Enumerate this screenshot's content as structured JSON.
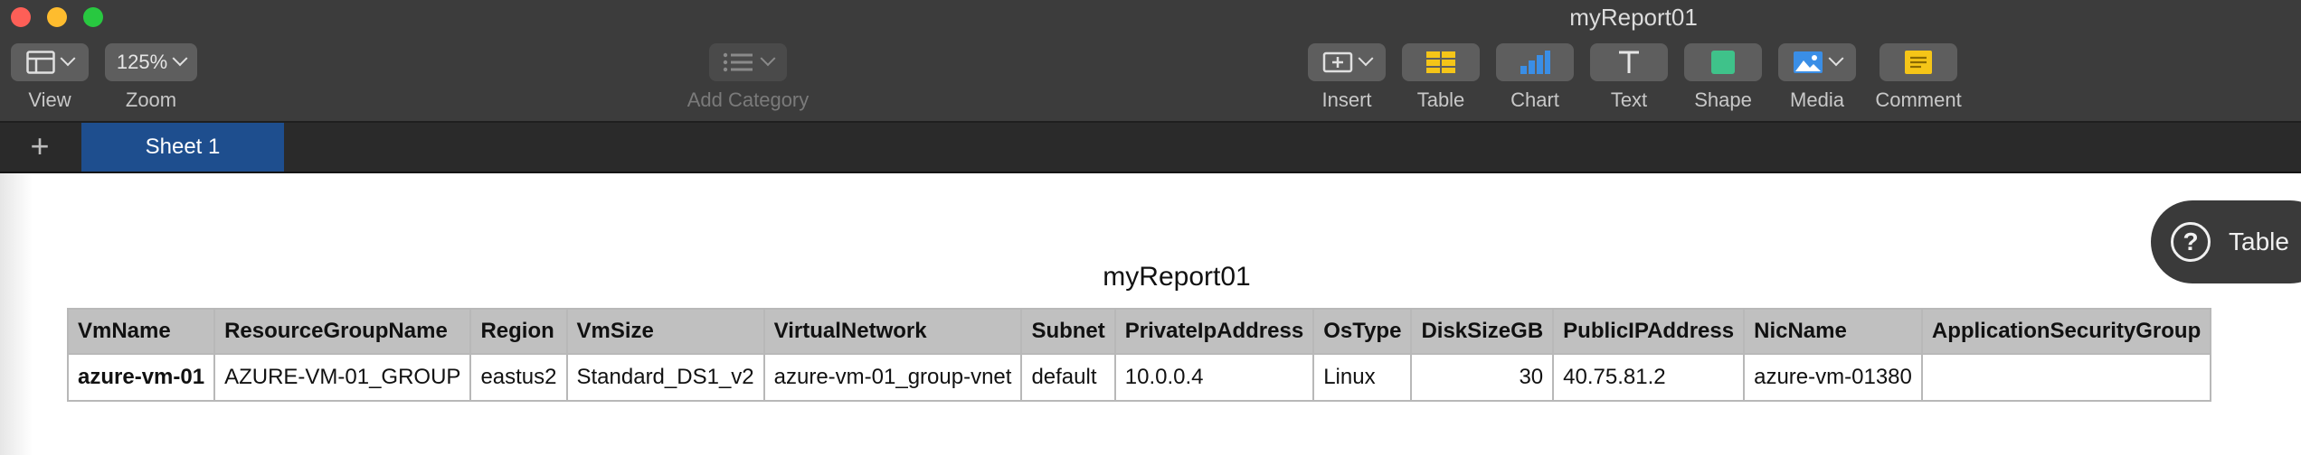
{
  "window": {
    "title": "myReport01"
  },
  "toolbar": {
    "view_label": "View",
    "zoom_value": "125%",
    "zoom_label": "Zoom",
    "add_category_label": "Add Category",
    "insert_label": "Insert",
    "table_label": "Table",
    "chart_label": "Chart",
    "text_label": "Text",
    "shape_label": "Shape",
    "media_label": "Media",
    "comment_label": "Comment"
  },
  "sheets": {
    "add_symbol": "+",
    "active": "Sheet 1"
  },
  "report": {
    "title": "myReport01",
    "columns": [
      "VmName",
      "ResourceGroupName",
      "Region",
      "VmSize",
      "VirtualNetwork",
      "Subnet",
      "PrivateIpAddress",
      "OsType",
      "DiskSizeGB",
      "PublicIPAddress",
      "NicName",
      "ApplicationSecurityGroup"
    ],
    "rows": [
      [
        "azure-vm-01",
        "AZURE-VM-01_GROUP",
        "eastus2",
        "Standard_DS1_v2",
        "azure-vm-01_group-vnet",
        "default",
        "10.0.0.4",
        "Linux",
        "30",
        "40.75.81.2",
        "azure-vm-01380",
        ""
      ]
    ]
  },
  "help": {
    "symbol": "?",
    "label": "Table"
  },
  "colors": {
    "toolbar_bg": "#3c3c3c",
    "tab_active": "#1e4e8e",
    "table_header_bg": "#c0c0c0",
    "icon_yellow": "#f5c518",
    "icon_blue": "#3a8ee6",
    "icon_green": "#3fc28a"
  }
}
